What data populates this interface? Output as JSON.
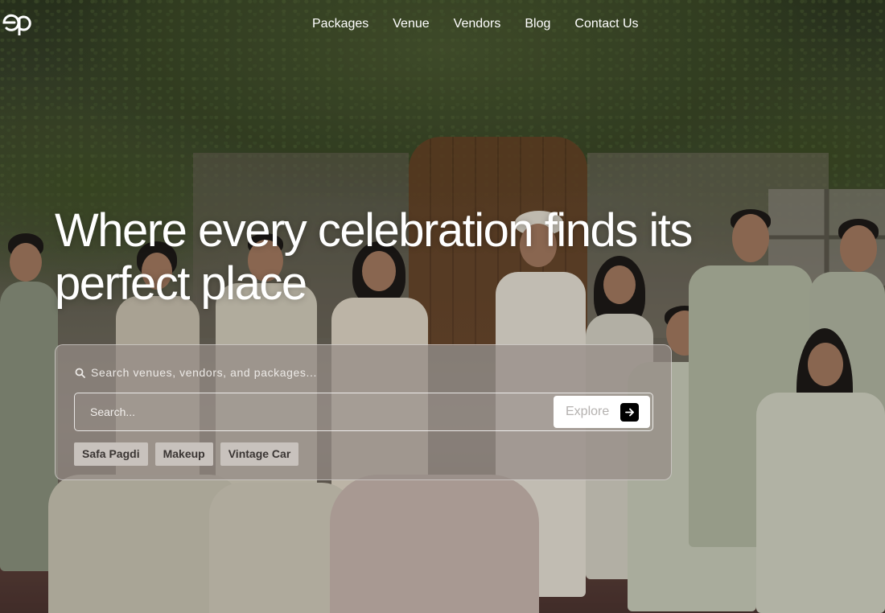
{
  "brand": {
    "logo_text": "ep",
    "logo_icon": "ep-monogram-logo"
  },
  "nav": {
    "items": [
      {
        "label": "Packages"
      },
      {
        "label": "Venue"
      },
      {
        "label": "Vendors"
      },
      {
        "label": "Blog"
      },
      {
        "label": "Contact Us"
      }
    ]
  },
  "hero": {
    "headline_line1": "Where every celebration finds its",
    "headline_line2": "perfect place"
  },
  "search": {
    "hint_icon": "search-icon",
    "hint_text": "Search venues, vendors, and packages...",
    "placeholder": "Search...",
    "value": "",
    "explore_label": "Explore",
    "explore_icon": "arrow-right-icon",
    "chips": [
      {
        "label": "Safa Pagdi"
      },
      {
        "label": "Makeup"
      },
      {
        "label": "Vintage Car"
      }
    ]
  },
  "colors": {
    "text_primary": "#ffffff",
    "card_bg": "#968c87",
    "chip_bg": "#c8c2bd",
    "explore_arrow_bg": "#000000"
  }
}
